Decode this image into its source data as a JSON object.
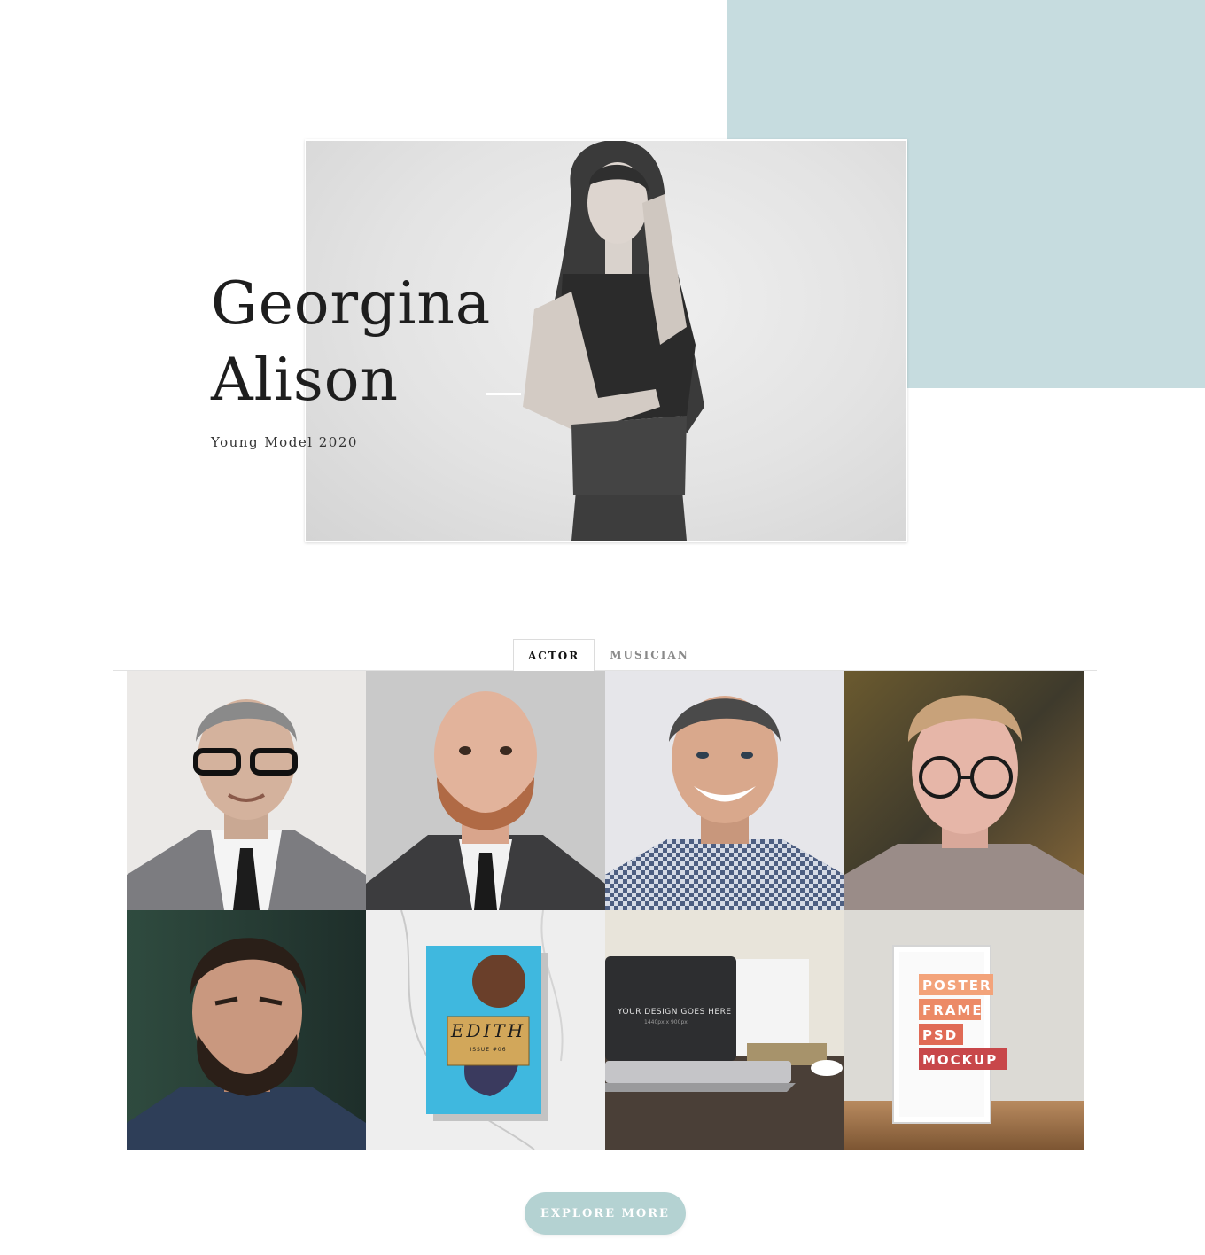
{
  "hero": {
    "first_name": "Georgina",
    "last_name": "Alison",
    "subtitle": "Young Model 2020"
  },
  "tabs": [
    {
      "label": "ACTOR",
      "active": true
    },
    {
      "label": "MUSICIAN",
      "active": false
    }
  ],
  "gallery": {
    "items": [
      {
        "alt": "man-in-glasses-suit"
      },
      {
        "alt": "bald-man-suit"
      },
      {
        "alt": "smiling-man-checkered-shirt"
      },
      {
        "alt": "young-man-round-glasses"
      },
      {
        "alt": "bearded-man"
      },
      {
        "alt": "magazine-mockup",
        "magazine_title": "EDITH",
        "magazine_issue": "ISSUE #06"
      },
      {
        "alt": "laptop-mockup",
        "screen_text": "YOUR DESIGN GOES HERE",
        "screen_subtext": "1440px x 900px"
      },
      {
        "alt": "poster-frame-mockup",
        "poster_lines": [
          "POSTER",
          "FRAME",
          "PSD",
          "MOCKUP"
        ]
      }
    ]
  },
  "cta": {
    "explore_label": "EXPLORE MORE"
  },
  "colors": {
    "accent": "#c6dcdf",
    "button": "#b4d2d2"
  }
}
